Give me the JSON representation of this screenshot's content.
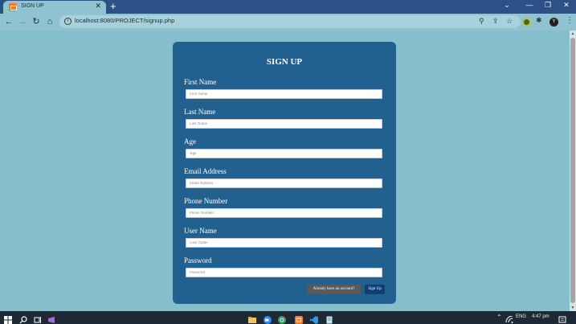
{
  "browser": {
    "tab_title": "SIGN UP",
    "tab_close": "✕",
    "new_tab": "+",
    "url": "localhost:8080/PROJECT/signup.php",
    "window_controls": [
      "⌄",
      "—",
      "❐",
      "✕"
    ],
    "extension_avatar_letter": "Y",
    "menu": "⋮"
  },
  "form": {
    "title": "SIGN UP",
    "fields": [
      {
        "label": "First Name",
        "placeholder": "First Name"
      },
      {
        "label": "Last Name",
        "placeholder": "Last Name"
      },
      {
        "label": "Age",
        "placeholder": "Age"
      },
      {
        "label": "Email Address",
        "placeholder": "Email Address"
      },
      {
        "label": "Phone Number",
        "placeholder": "Phone Number"
      },
      {
        "label": "User Name",
        "placeholder": "User Name"
      },
      {
        "label": "Password",
        "placeholder": "Password"
      }
    ],
    "login_link": "Already have an account?",
    "submit": "Sign Up"
  },
  "taskbar": {
    "language": "ENG",
    "time": "4:47 pm"
  },
  "colors": {
    "page_background": "#86bfcc",
    "card": "#22618f",
    "signup_button": "#0d3f72",
    "login_button": "#5a5a5a"
  }
}
